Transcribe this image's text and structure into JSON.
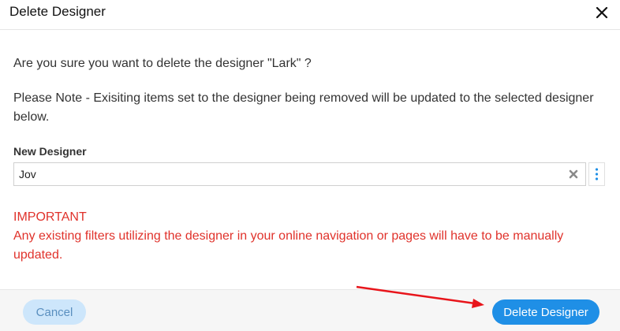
{
  "dialog": {
    "title": "Delete Designer",
    "confirm_message": "Are you sure you want to delete the designer \"Lark\" ?",
    "note_message": "Please Note - Exisiting items set to the designer being removed will be updated to the selected designer below.",
    "field": {
      "label": "New Designer",
      "value": "Jov"
    },
    "important": {
      "heading": "IMPORTANT",
      "message": "Any existing filters utilizing the designer in your online navigation or pages will have to be manually updated."
    },
    "footer": {
      "cancel_label": "Cancel",
      "delete_label": "Delete Designer"
    }
  },
  "icons": {
    "close": "close-icon",
    "clear": "clear-icon",
    "options": "vertical-dots-icon",
    "annotation": "arrow-annotation"
  },
  "colors": {
    "primary": "#1f8fe6",
    "cancel_bg": "#cde6fb",
    "important_text": "#e0322b",
    "arrow": "#e8151b"
  }
}
